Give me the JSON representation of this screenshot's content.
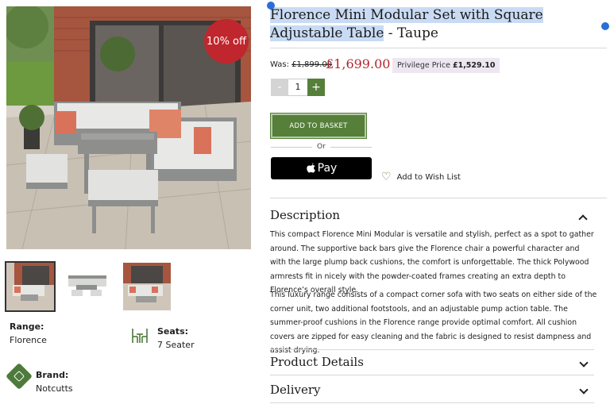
{
  "product": {
    "title_part1": "Florence Mini Modular Set with Square Adjustable Table",
    "title_part2": " - Taupe",
    "discount_badge": "10% off",
    "was_label": "Was:",
    "was_price": "£1,899.00",
    "price": "£1,699.00",
    "privilege_label": "Privilege Price",
    "privilege_price": "£1,529.10"
  },
  "quantity": {
    "minus": "-",
    "value": "1",
    "plus": "+"
  },
  "actions": {
    "add_to_basket": "ADD TO BASKET",
    "or": "Or",
    "apple_pay": "Pay",
    "wish_list": "Add to Wish List"
  },
  "specs": {
    "range_label": "Range:",
    "range_value": "Florence",
    "seats_label": "Seats:",
    "seats_value": "7 Seater",
    "brand_label": "Brand:",
    "brand_value": "Notcutts"
  },
  "description": {
    "heading": "Description",
    "paragraph1": "This compact Florence Mini Modular is versatile and stylish, perfect as a spot to gather around. The supportive back bars give the Florence chair a powerful character and with the large plump back cushions, the comfort is unforgettable. The thick Polywood armrests fit in nicely with the powder-coated frames creating an extra depth to Florence’s overall style.",
    "paragraph2": "This luxury range consists of a compact corner sofa with two seats on either side of the corner unit, two additional footstools, and an adjustable pump action table. The summer-proof cushions in the Florence range provide optimal comfort. All cushion covers are zipped for easy cleaning and the fabric is designed to resist dampness and assist drying."
  },
  "sections": {
    "product_details": "Product Details",
    "delivery": "Delivery"
  },
  "colors": {
    "accent_green": "#567f3a",
    "sale_red": "#b1272e",
    "badge_red": "#c0262d"
  }
}
